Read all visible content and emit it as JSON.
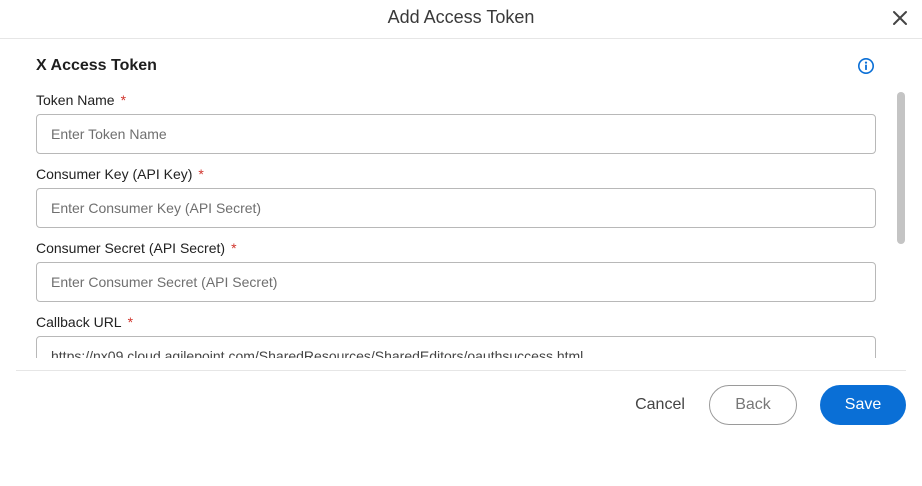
{
  "dialog": {
    "title": "Add Access Token",
    "close_icon": "close-icon"
  },
  "section": {
    "title": "X Access Token",
    "info_icon": "info-icon"
  },
  "fields": [
    {
      "label": "Token Name",
      "required_mark": "*",
      "placeholder": "Enter Token Name",
      "value": ""
    },
    {
      "label": "Consumer Key (API Key)",
      "required_mark": "*",
      "placeholder": "Enter Consumer Key (API Secret)",
      "value": ""
    },
    {
      "label": "Consumer Secret (API Secret)",
      "required_mark": "*",
      "placeholder": "Enter Consumer Secret (API Secret)",
      "value": ""
    },
    {
      "label": "Callback URL",
      "required_mark": "*",
      "placeholder": "",
      "value": "https://nx09.cloud.agilepoint.com/SharedResources/SharedEditors/oauthsuccess.html"
    }
  ],
  "footer": {
    "cancel_label": "Cancel",
    "back_label": "Back",
    "save_label": "Save"
  },
  "colors": {
    "primary": "#0a6fd6",
    "required": "#d0342c"
  }
}
